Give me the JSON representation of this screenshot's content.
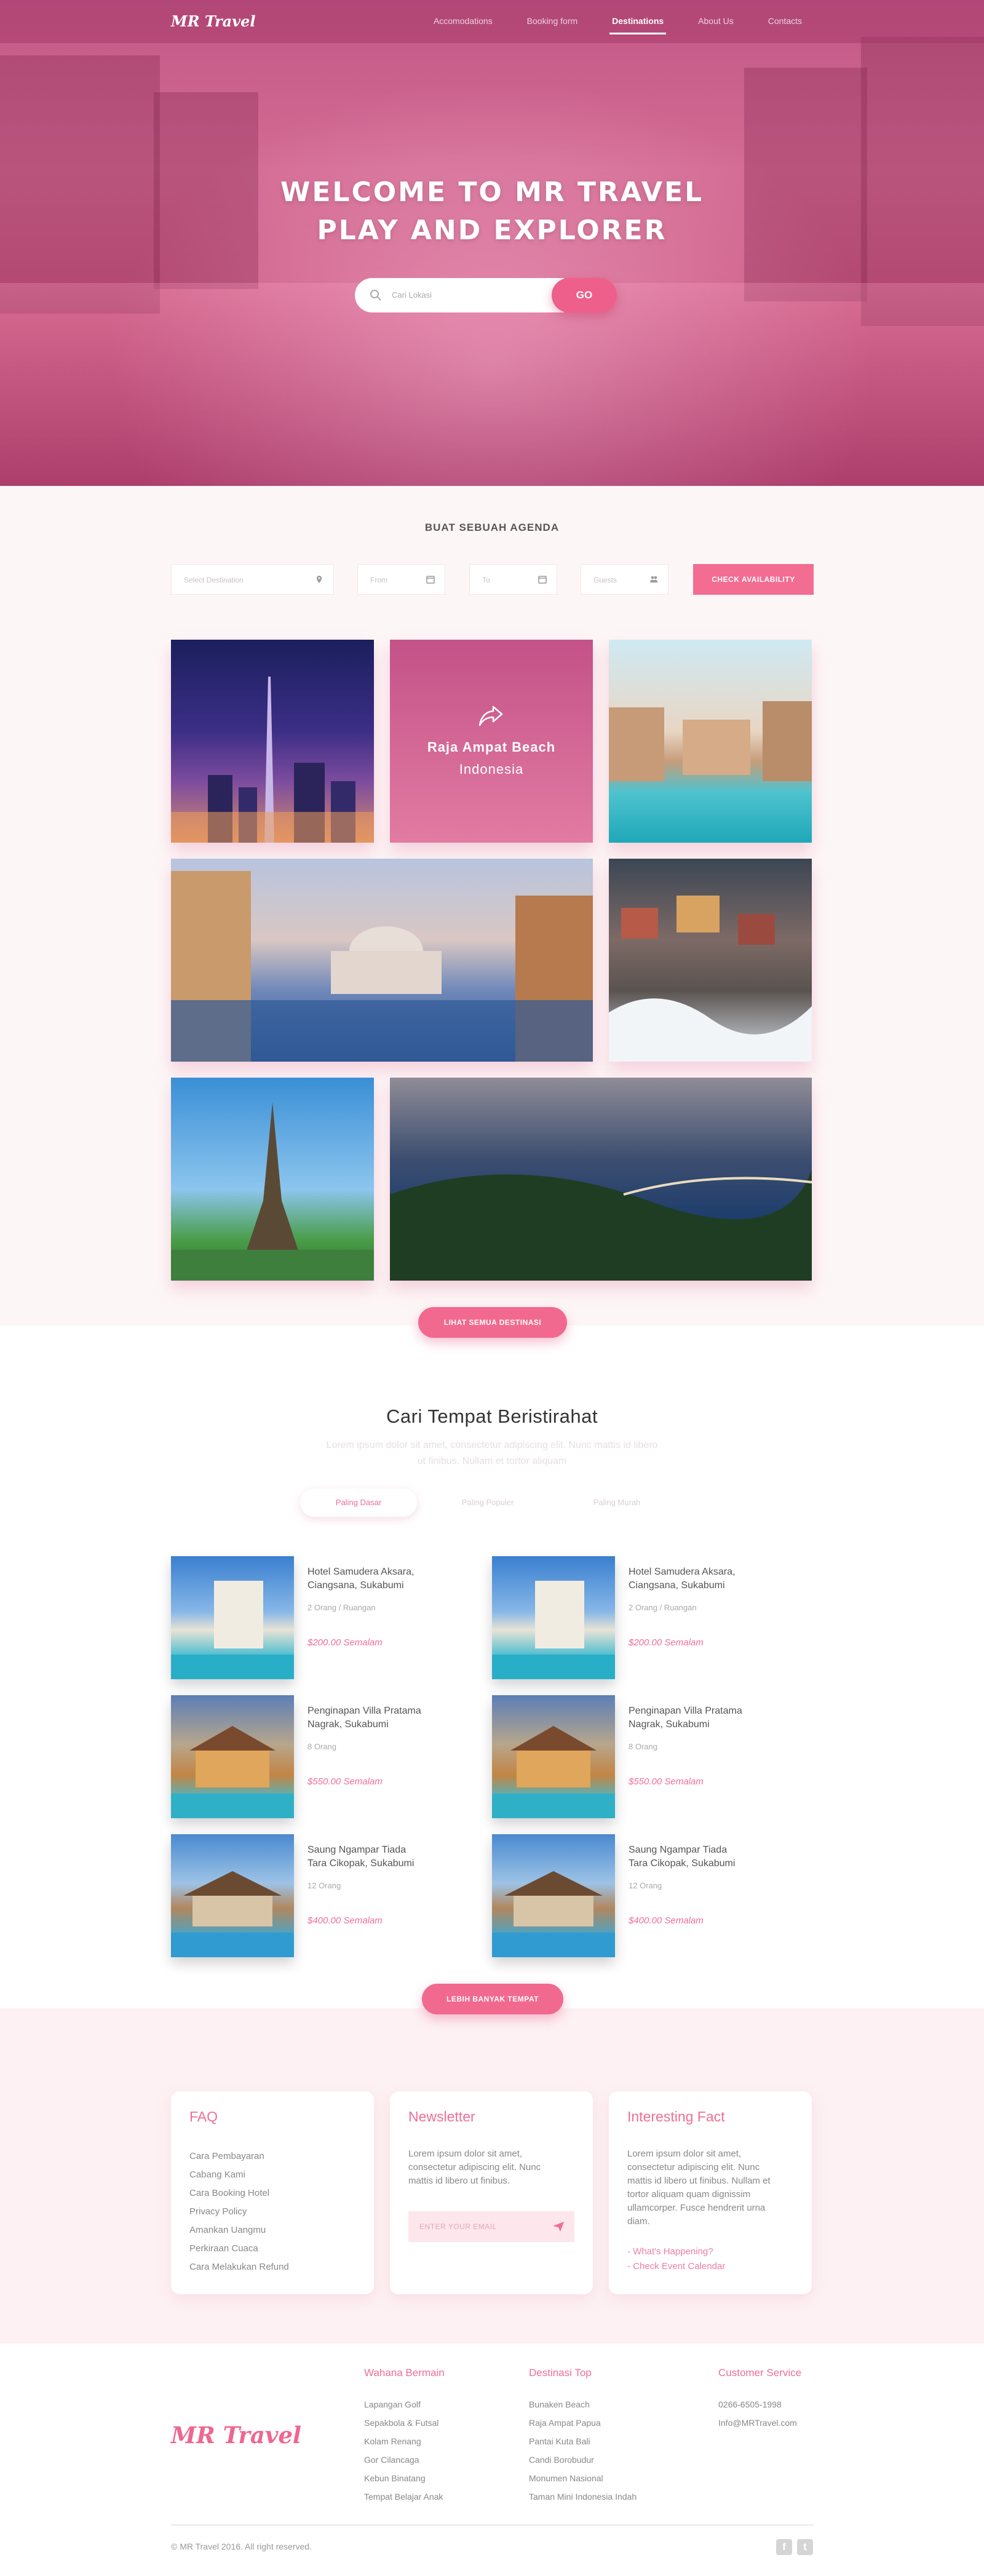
{
  "nav": {
    "logo": "MR Travel",
    "items": [
      "Accomodations",
      "Booking form",
      "Destinations",
      "About Us",
      "Contacts"
    ],
    "active_index": 2
  },
  "hero": {
    "title_line1": "WELCOME TO MR TRAVEL",
    "title_line2": "PLAY AND EXPLORER",
    "search_placeholder": "Cari Lokasi",
    "go_label": "GO"
  },
  "agenda": {
    "heading": "BUAT SEBUAH AGENDA",
    "destination_placeholder": "Select Destination",
    "from_placeholder": "From",
    "to_placeholder": "To",
    "guests_placeholder": "Guests",
    "check_label": "CHECK AVAILABILITY",
    "featured_title": "Raja Ampat Beach",
    "featured_subtitle": "Indonesia",
    "see_all_label": "LIHAT SEMUA DESTINASI"
  },
  "lodging": {
    "title": "Cari Tempat Beristirahat",
    "subtitle_line1": "Lorem ipsum dolor sit amet, consectetur adipiscing elit. Nunc mattis id libero",
    "subtitle_line2": "ut finibus. Nullam et tortor aliquam",
    "tabs": [
      "Paling Dasar",
      "Paling Populer",
      "Paling Murah"
    ],
    "active_tab": 0,
    "hotels": [
      {
        "name1": "Hotel Samudera Aksara,",
        "name2": "Ciangsana, Sukabumi",
        "guests": "2 Orang / Ruangan",
        "price": "$200.00 Semalam"
      },
      {
        "name1": "Hotel Samudera Aksara,",
        "name2": "Ciangsana, Sukabumi",
        "guests": "2 Orang / Ruangan",
        "price": "$200.00 Semalam"
      },
      {
        "name1": "Penginapan Villa Pratama",
        "name2": "Nagrak, Sukabumi",
        "guests": "8 Orang",
        "price": "$550.00 Semalam"
      },
      {
        "name1": "Penginapan Villa Pratama",
        "name2": "Nagrak, Sukabumi",
        "guests": "8 Orang",
        "price": "$550.00 Semalam"
      },
      {
        "name1": "Saung Ngampar Tiada",
        "name2": "Tara Cikopak, Sukabumi",
        "guests": "12 Orang",
        "price": "$400.00 Semalam"
      },
      {
        "name1": "Saung Ngampar Tiada",
        "name2": "Tara Cikopak, Sukabumi",
        "guests": "12 Orang",
        "price": "$400.00 Semalam"
      }
    ],
    "more_label": "LEBIH BANYAK TEMPAT"
  },
  "faq": {
    "title": "FAQ",
    "items": [
      "Cara Pembayaran",
      "Cabang Kami",
      "Cara Booking Hotel",
      "Privacy Policy",
      "Amankan Uangmu",
      "Perkiraan Cuaca",
      "Cara Melakukan Refund"
    ]
  },
  "newsletter": {
    "title": "Newsletter",
    "text_line1": "Lorem ipsum dolor sit amet,",
    "text_line2": "consectetur adipiscing elit. Nunc",
    "text_line3": "mattis id libero ut finibus.",
    "email_placeholder": "ENTER YOUR EMAIL"
  },
  "fact": {
    "title": "Interesting Fact",
    "text_line1": "Lorem ipsum dolor sit amet,",
    "text_line2": "consectetur adipiscing elit. Nunc",
    "text_line3": "mattis id libero ut finibus. Nullam et",
    "text_line4": "tortor aliquam quam dignissim",
    "text_line5": "ullamcorper. Fusce hendrerit urna",
    "text_line6": "diam.",
    "link1": "- What's Happening?",
    "link2": "- Check Event Calendar"
  },
  "footer": {
    "logo": "MR Travel",
    "col1_title": "Wahana Bermain",
    "col1_items": [
      "Lapangan Golf",
      "Sepakbola & Futsal",
      "Kolam Renang",
      "Gor Cilancaga",
      "Kebun Binatang",
      "Tempat Belajar Anak"
    ],
    "col2_title": "Destinasi Top",
    "col2_items": [
      "Bunaken Beach",
      "Raja Ampat Papua",
      "Pantai Kuta Bali",
      "Candi Borobudur",
      "Monumen Nasional",
      "Taman Mini Indonesia Indah"
    ],
    "col3_title": "Customer Service",
    "col3_items": [
      "0266-6505-1998",
      "Info@MRTravel.com"
    ],
    "copyright": "© MR Travel 2016. All right reserved.",
    "social": [
      "f",
      "t"
    ]
  },
  "colors": {
    "accent": "#f2698f",
    "hero": "#c9567f",
    "section_bg": "#fdf6f7"
  }
}
